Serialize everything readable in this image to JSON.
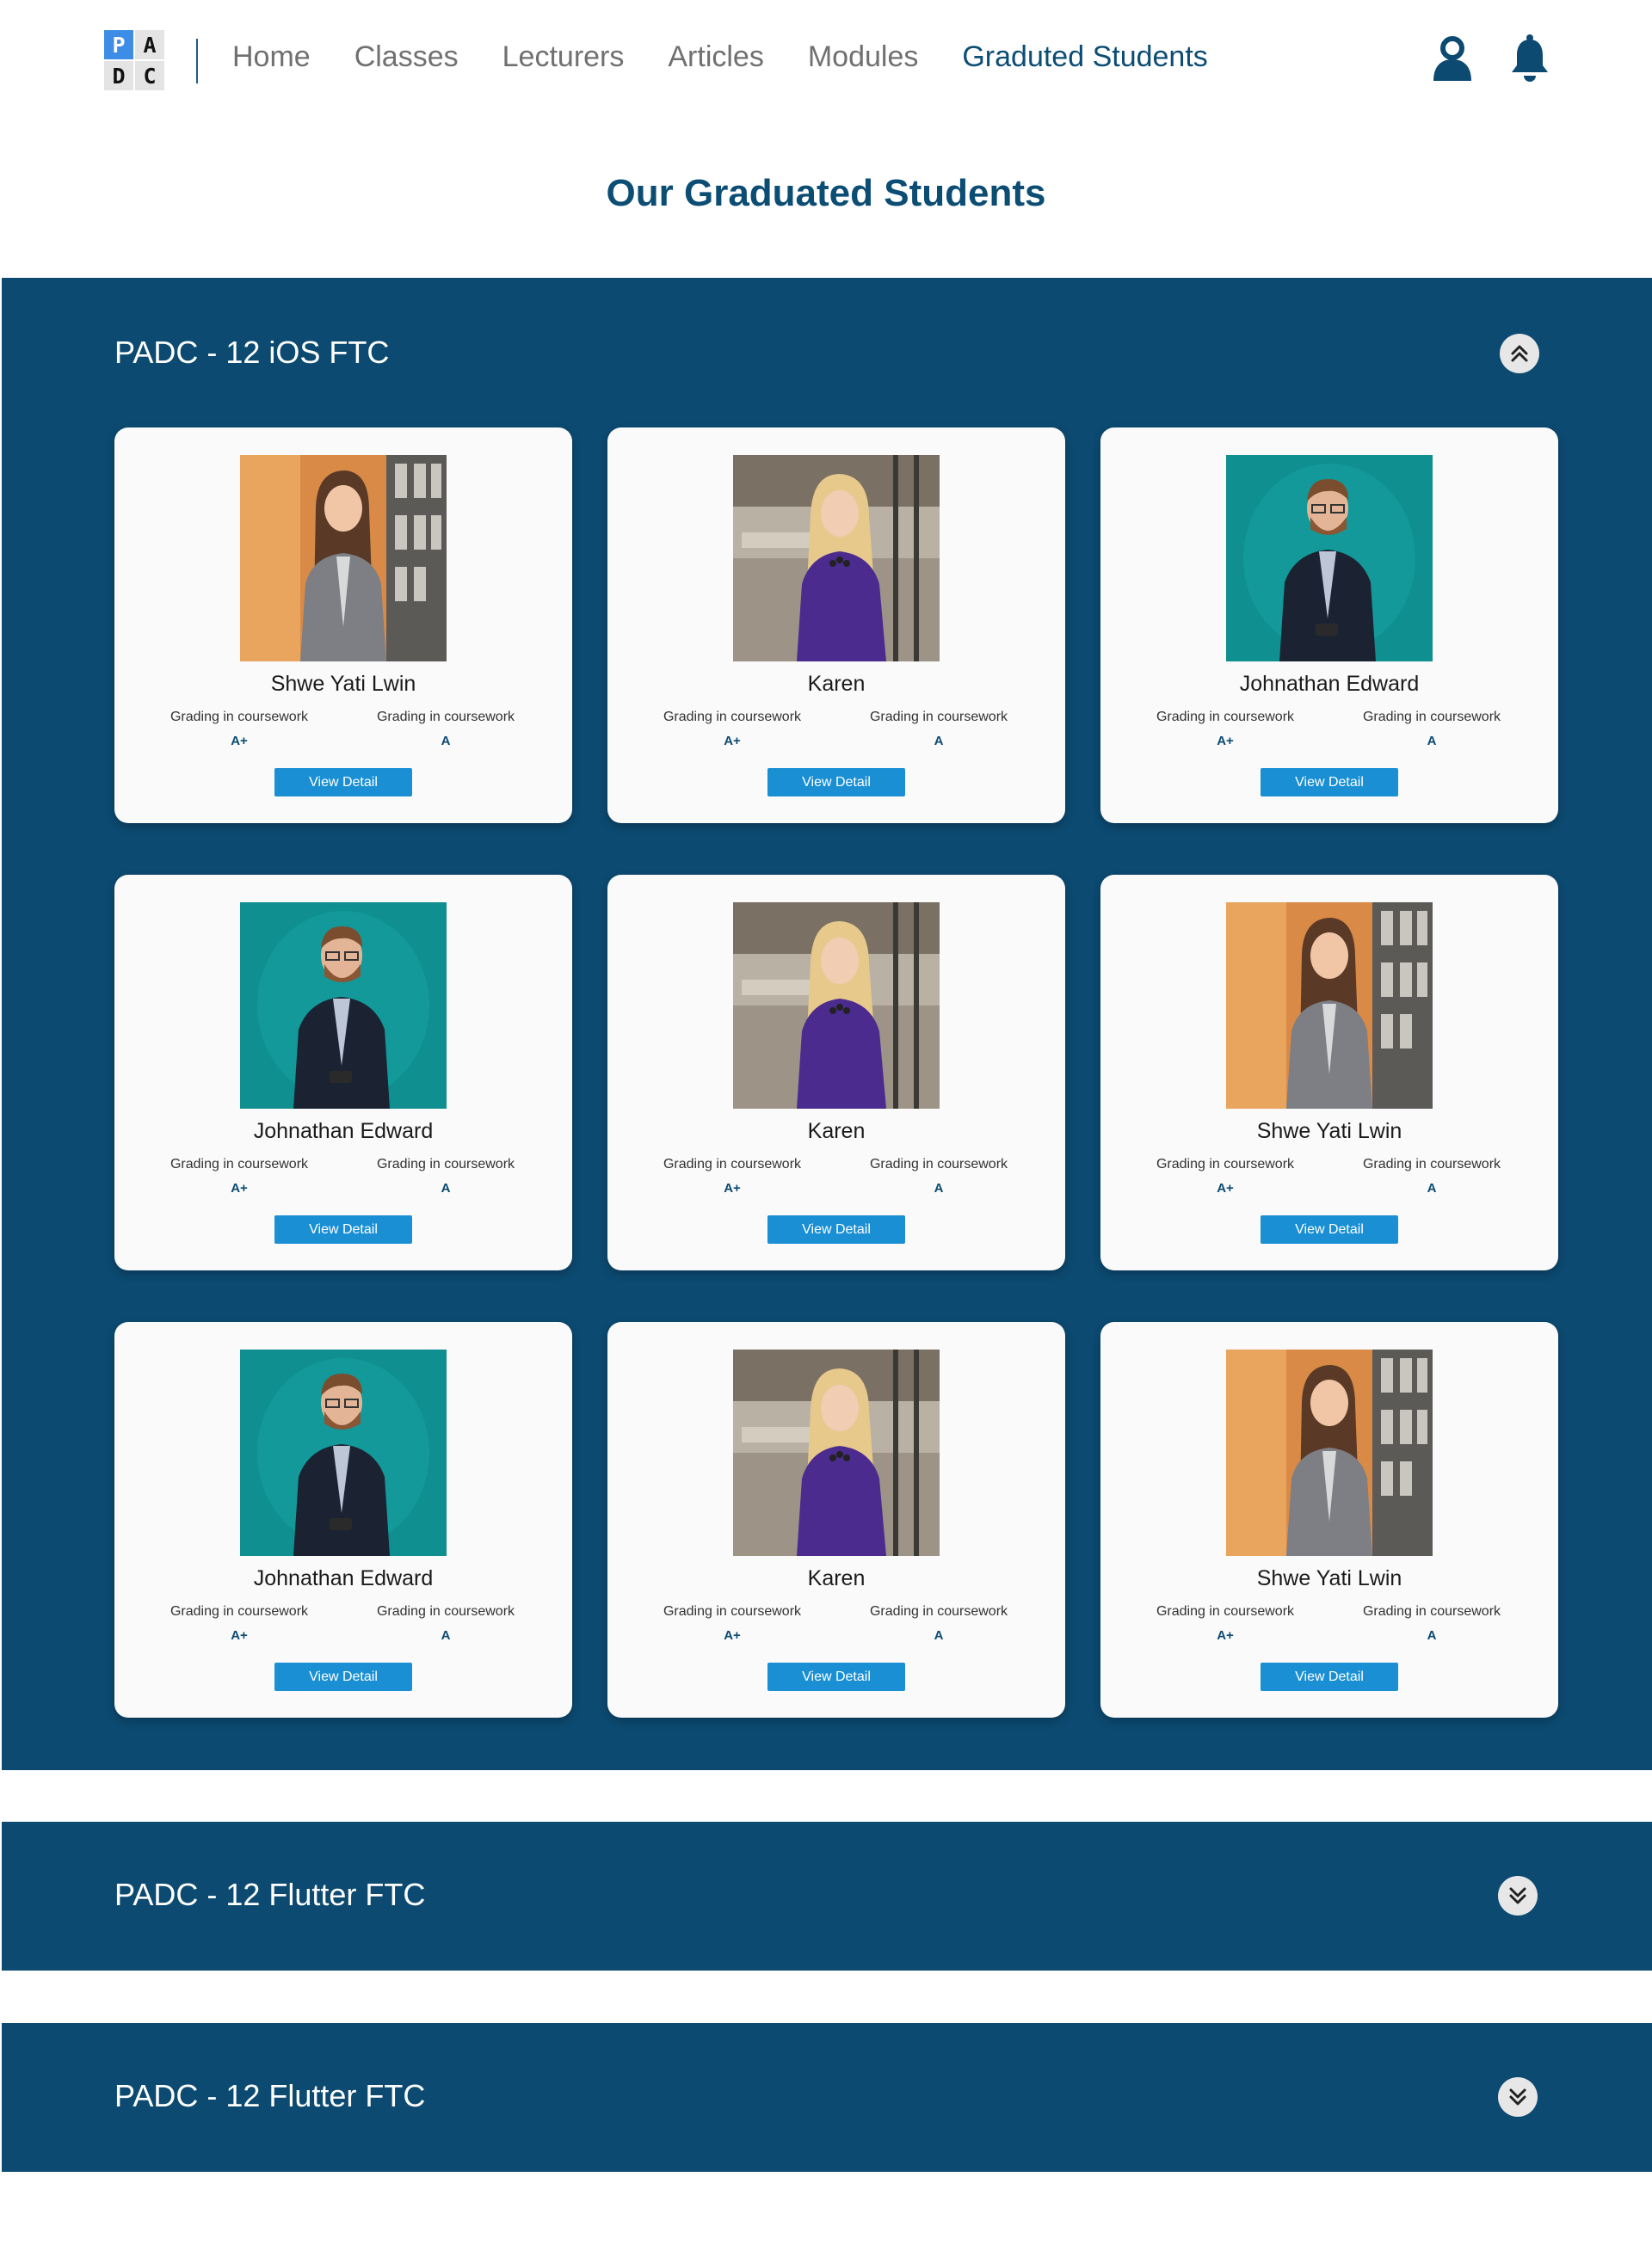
{
  "brand": {
    "logo_letters": [
      "P",
      "A",
      "D",
      "C"
    ]
  },
  "nav": {
    "links": [
      {
        "label": "Home",
        "active": false
      },
      {
        "label": "Classes",
        "active": false
      },
      {
        "label": "Lecturers",
        "active": false
      },
      {
        "label": "Articles",
        "active": false
      },
      {
        "label": "Modules",
        "active": false
      },
      {
        "label": "Graduted Students",
        "active": true
      }
    ],
    "icons": [
      "user-icon",
      "bell-icon"
    ]
  },
  "page": {
    "title": "Our Graduated Students"
  },
  "colors": {
    "primary": "#0c4a71",
    "button": "#1a8fd4",
    "card": "#fafafa"
  },
  "sections": [
    {
      "title": "PADC - 12 iOS FTC",
      "expanded": true,
      "toggle_icon": "chevron-double-up-icon",
      "students": [
        {
          "name": "Shwe Yati Lwin",
          "photo": "orange",
          "grade1_label": "Grading in coursework",
          "grade1": "A+",
          "grade2_label": "Grading in coursework",
          "grade2": "A",
          "button": "View Detail"
        },
        {
          "name": "Karen",
          "photo": "office",
          "grade1_label": "Grading in coursework",
          "grade1": "A+",
          "grade2_label": "Grading in coursework",
          "grade2": "A",
          "button": "View Detail"
        },
        {
          "name": "Johnathan Edward",
          "photo": "teal",
          "grade1_label": "Grading in coursework",
          "grade1": "A+",
          "grade2_label": "Grading in coursework",
          "grade2": "A",
          "button": "View Detail"
        },
        {
          "name": "Johnathan Edward",
          "photo": "teal",
          "grade1_label": "Grading in coursework",
          "grade1": "A+",
          "grade2_label": "Grading in coursework",
          "grade2": "A",
          "button": "View Detail"
        },
        {
          "name": "Karen",
          "photo": "office",
          "grade1_label": "Grading in coursework",
          "grade1": "A+",
          "grade2_label": "Grading in coursework",
          "grade2": "A",
          "button": "View Detail"
        },
        {
          "name": "Shwe Yati Lwin",
          "photo": "orange",
          "grade1_label": "Grading in coursework",
          "grade1": "A+",
          "grade2_label": "Grading in coursework",
          "grade2": "A",
          "button": "View Detail"
        },
        {
          "name": "Johnathan Edward",
          "photo": "teal",
          "grade1_label": "Grading in coursework",
          "grade1": "A+",
          "grade2_label": "Grading in coursework",
          "grade2": "A",
          "button": "View Detail"
        },
        {
          "name": "Karen",
          "photo": "office",
          "grade1_label": "Grading in coursework",
          "grade1": "A+",
          "grade2_label": "Grading in coursework",
          "grade2": "A",
          "button": "View Detail"
        },
        {
          "name": "Shwe Yati Lwin",
          "photo": "orange",
          "grade1_label": "Grading in coursework",
          "grade1": "A+",
          "grade2_label": "Grading in coursework",
          "grade2": "A",
          "button": "View Detail"
        }
      ]
    },
    {
      "title": "PADC - 12 Flutter FTC",
      "expanded": false,
      "toggle_icon": "chevron-double-down-icon"
    },
    {
      "title": "PADC - 12 Flutter FTC",
      "expanded": false,
      "toggle_icon": "chevron-double-down-icon"
    }
  ]
}
